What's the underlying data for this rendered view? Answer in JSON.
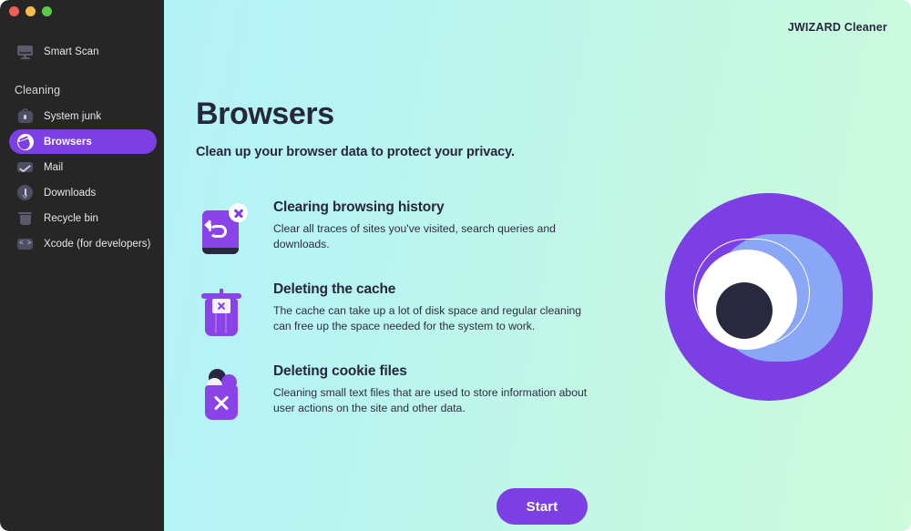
{
  "window": {
    "traffic_lights": [
      {
        "name": "close",
        "color": "#ee5f56"
      },
      {
        "name": "minimize",
        "color": "#f4bd4f"
      },
      {
        "name": "maximize",
        "color": "#5dc94c"
      }
    ]
  },
  "brand": {
    "name": "JWIZARD Cleaner"
  },
  "sidebar": {
    "top_items": [
      {
        "label": "Smart Scan",
        "icon": "monitor-icon"
      }
    ],
    "section_title": "Cleaning",
    "items": [
      {
        "label": "System junk",
        "icon": "lock-icon",
        "selected": false
      },
      {
        "label": "Browsers",
        "icon": "globe-icon",
        "selected": true
      },
      {
        "label": "Mail",
        "icon": "envelope-icon",
        "selected": false
      },
      {
        "label": "Downloads",
        "icon": "download-icon",
        "selected": false
      },
      {
        "label": "Recycle bin",
        "icon": "trash-icon",
        "selected": false
      },
      {
        "label": "Xcode (for developers)",
        "icon": "code-icon",
        "selected": false
      }
    ]
  },
  "main": {
    "title": "Browsers",
    "subtitle": "Clean up your browser data to protect your privacy.",
    "features": [
      {
        "title": "Clearing browsing history",
        "description": "Clear all traces of sites you've visited, search queries and downloads.",
        "icon": "history-card-x-icon"
      },
      {
        "title": "Deleting the cache",
        "description": "The cache can take up a lot of disk space and regular cleaning can free up the space needed for the system to work.",
        "icon": "trash-can-x-icon"
      },
      {
        "title": "Deleting cookie files",
        "description": "Cleaning small text files that are used to store information about user actions on the site and other data.",
        "icon": "cookie-bin-x-icon"
      }
    ],
    "illustration": {
      "name": "privacy-eye-illustration"
    },
    "start_button": "Start"
  },
  "colors": {
    "accent_purple": "#7b3fe4",
    "icon_purple": "#8a43e6",
    "sidebar_bg": "#262626",
    "text_dark": "#27273c",
    "bg_gradient_start": "#b2f0fb",
    "bg_gradient_end": "#cdfbdc",
    "eye_blue": "#8aa7f6",
    "pupil_dark": "#28283f"
  }
}
